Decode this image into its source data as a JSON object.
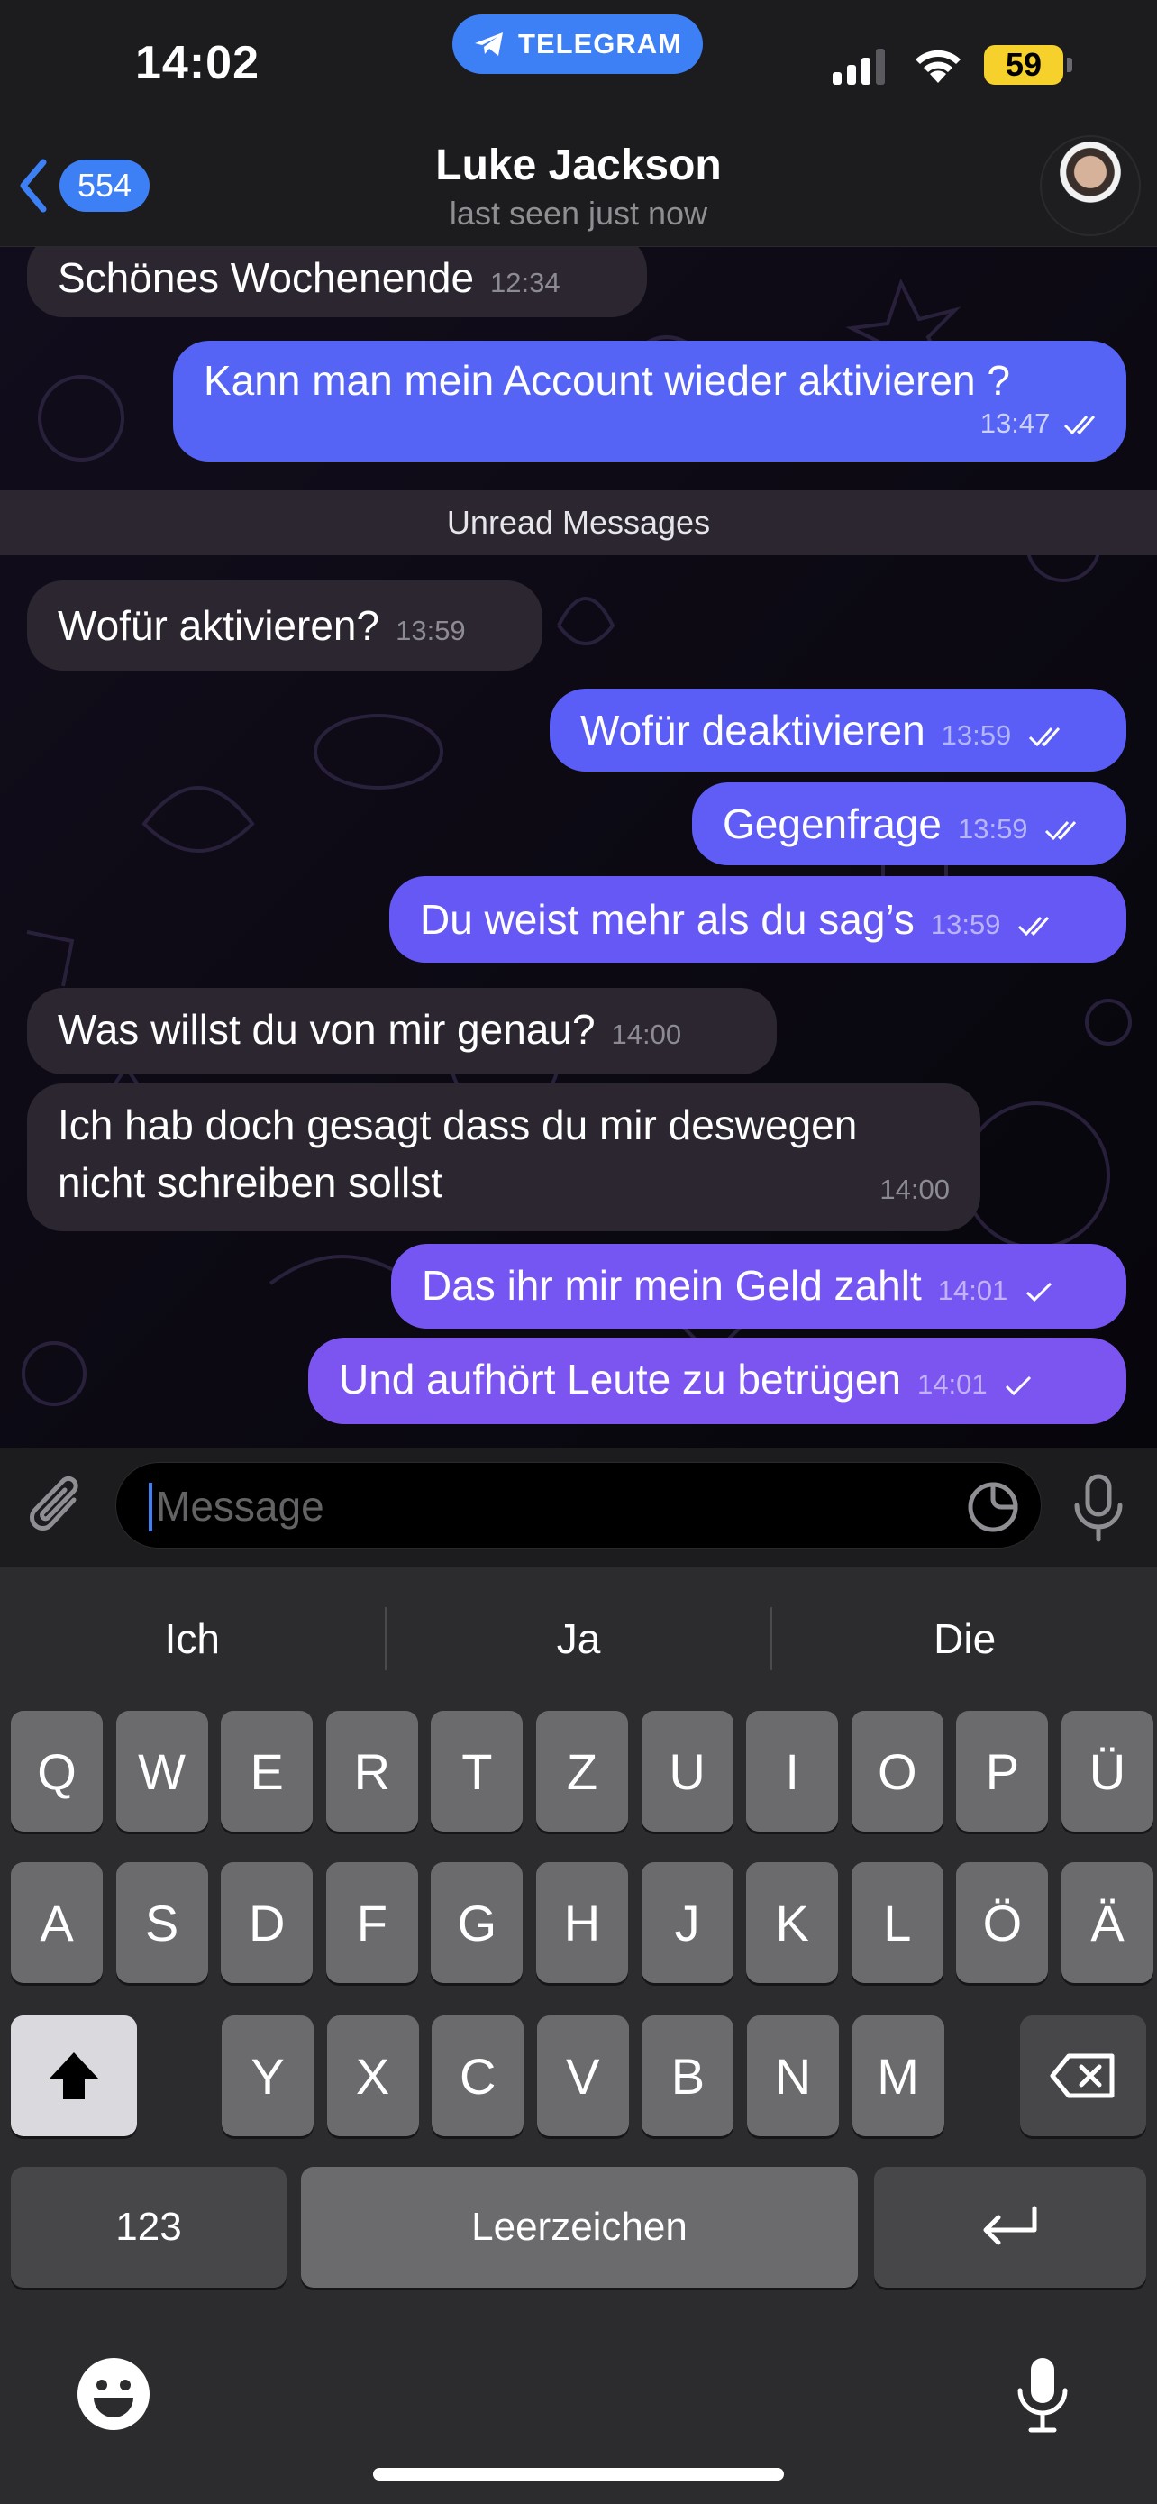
{
  "status_bar": {
    "time": "14:02",
    "app_pill": "TELEGRAM",
    "battery": "59",
    "colors": {
      "accent": "#3d7ff5",
      "battery": "#f6d02b"
    }
  },
  "header": {
    "back_count": "554",
    "contact_name": "Luke Jackson",
    "contact_status": "last seen just now"
  },
  "messages": [
    {
      "dir": "in",
      "text": "Schönes Wochenende",
      "time": "12:34"
    },
    {
      "dir": "out",
      "text": "Kann man mein Account wieder aktivieren ?",
      "time": "13:47",
      "read": true
    },
    {
      "dir": "in",
      "text": "Wofür aktivieren?",
      "time": "13:59"
    },
    {
      "dir": "out",
      "text": "Wofür deaktivieren",
      "time": "13:59",
      "read": true
    },
    {
      "dir": "out",
      "text": "Gegenfrage",
      "time": "13:59",
      "read": true
    },
    {
      "dir": "out",
      "text": "Du weist mehr als du sag’s",
      "time": "13:59",
      "read": true
    },
    {
      "dir": "in",
      "text": "Was willst du von mir genau?",
      "time": "14:00"
    },
    {
      "dir": "in",
      "text_line1": "Ich hab doch gesagt dass du mir deswegen",
      "text_line2": "nicht schreiben sollst",
      "time": "14:00"
    },
    {
      "dir": "out",
      "text": "Das ihr mir mein Geld zahlt",
      "time": "14:01",
      "read": false
    },
    {
      "dir": "out",
      "text": "Und aufhört Leute zu betrügen",
      "time": "14:01",
      "read": false
    }
  ],
  "unread_divider": "Unread Messages",
  "input": {
    "placeholder": "Message"
  },
  "keyboard": {
    "suggestions": [
      "Ich",
      "Ja",
      "Die"
    ],
    "row1": [
      "Q",
      "W",
      "E",
      "R",
      "T",
      "Z",
      "U",
      "I",
      "O",
      "P",
      "Ü"
    ],
    "row2": [
      "A",
      "S",
      "D",
      "F",
      "G",
      "H",
      "J",
      "K",
      "L",
      "Ö",
      "Ä"
    ],
    "row3": [
      "Y",
      "X",
      "C",
      "V",
      "B",
      "N",
      "M"
    ],
    "numbers_label": "123",
    "space_label": "Leerzeichen"
  },
  "icons": [
    "telegram-icon",
    "back-chevron-icon",
    "attach-icon",
    "sticker-icon",
    "mic-icon",
    "shift-icon",
    "backspace-icon",
    "return-icon",
    "emoji-icon",
    "dictation-icon",
    "read-ticks-icon",
    "sent-tick-icon"
  ]
}
